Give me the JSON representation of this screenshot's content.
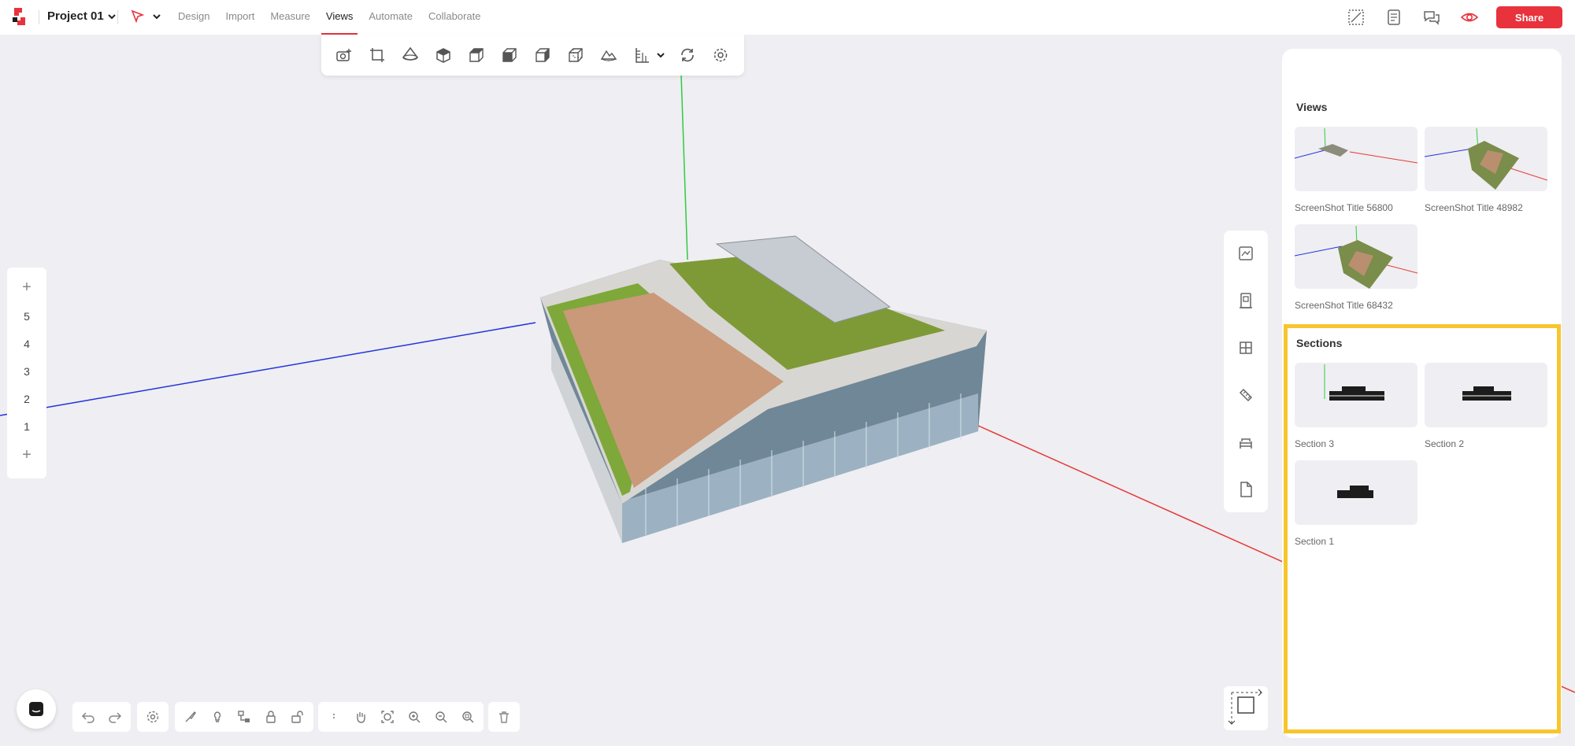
{
  "header": {
    "project_name": "Project 01",
    "menu": [
      "Design",
      "Import",
      "Measure",
      "Views",
      "Automate",
      "Collaborate"
    ],
    "active_menu": "Views",
    "share_label": "Share"
  },
  "view_toolbar": {
    "icons": [
      "camera-add-icon",
      "crop-icon",
      "perspective-icon",
      "iso-view-icon",
      "top-view-icon",
      "front-view-icon",
      "right-view-icon",
      "back-view-icon",
      "terrain-icon",
      "elevation-icon",
      "rotate-icon",
      "settings-icon"
    ]
  },
  "levels": {
    "items": [
      "5",
      "4",
      "3",
      "2",
      "1"
    ]
  },
  "panel": {
    "views_title": "Views",
    "views": [
      {
        "label": "ScreenShot Title 56800"
      },
      {
        "label": "ScreenShot Title 48982"
      },
      {
        "label": "ScreenShot Title 68432"
      }
    ],
    "sections_title": "Sections",
    "sections": [
      {
        "label": "Section 3"
      },
      {
        "label": "Section 2"
      },
      {
        "label": "Section 1"
      }
    ]
  },
  "colors": {
    "accent": "#e8323c",
    "highlight": "#f7c52e",
    "axis_x": "#e53935",
    "axis_y": "#2ecc40",
    "axis_z": "#2233dd"
  }
}
